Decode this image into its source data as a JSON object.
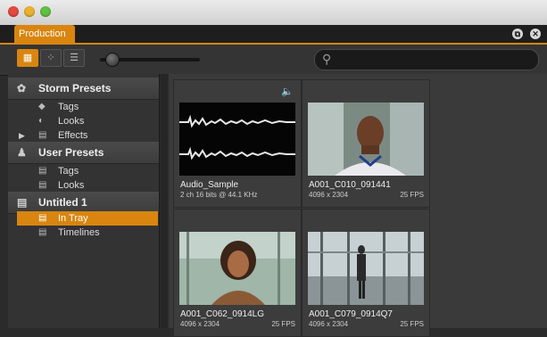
{
  "window": {
    "title_tab": "Production"
  },
  "toolbar": {
    "view_buttons": [
      "grid-large",
      "grid-small",
      "list"
    ],
    "search": {
      "placeholder": "",
      "value": ""
    }
  },
  "sidebar": {
    "sections": [
      {
        "label": "Storm Presets",
        "icon": "storm-icon",
        "items": [
          {
            "label": "Tags",
            "icon": "tags-icon"
          },
          {
            "label": "Looks",
            "icon": "looks-icon"
          },
          {
            "label": "Effects",
            "icon": "effects-icon",
            "expandable": true
          }
        ]
      },
      {
        "label": "User Presets",
        "icon": "user-icon",
        "items": [
          {
            "label": "Tags",
            "icon": "tags-icon"
          },
          {
            "label": "Looks",
            "icon": "looks-icon"
          }
        ]
      },
      {
        "label": "Untitled 1",
        "icon": "project-icon",
        "items": [
          {
            "label": "In Tray",
            "icon": "tray-icon",
            "selected": true
          },
          {
            "label": "Timelines",
            "icon": "timelines-icon"
          }
        ]
      }
    ]
  },
  "clips": [
    {
      "name": "Audio_Sample",
      "info": "2 ch 16 bits @ 44.1 KHz",
      "fps": "",
      "kind": "audio"
    },
    {
      "name": "A001_C010_091441",
      "info": "4096 x 2304",
      "fps": "25 FPS",
      "kind": "video"
    },
    {
      "name": "A001_C062_0914LG",
      "info": "4096 x 2304",
      "fps": "25 FPS",
      "kind": "video"
    },
    {
      "name": "A001_C079_0914Q7",
      "info": "4096 x 2304",
      "fps": "25 FPS",
      "kind": "video"
    }
  ],
  "colors": {
    "accent": "#d9850f",
    "panel": "#333333",
    "background": "#2b2b2b"
  }
}
